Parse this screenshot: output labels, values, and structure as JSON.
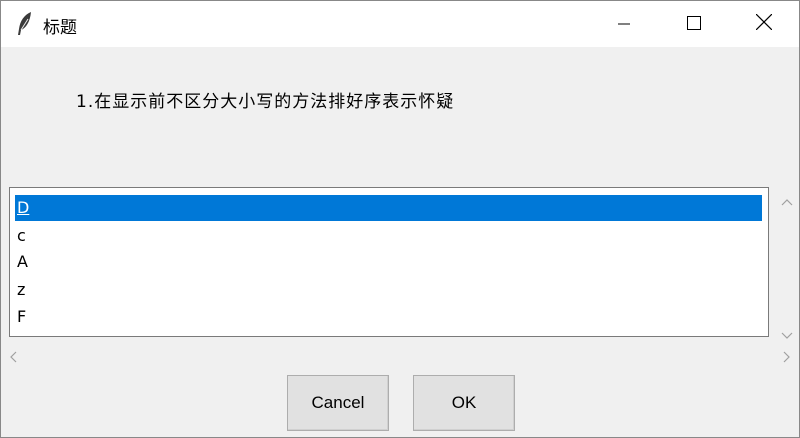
{
  "window": {
    "title": "标题"
  },
  "dialog": {
    "message": "1.在显示前不区分大小写的方法排好序表示怀疑",
    "list": {
      "items": [
        "D",
        "c",
        "A",
        "z",
        "F"
      ],
      "selected_index": 0
    },
    "buttons": {
      "cancel_label": "Cancel",
      "ok_label": "OK"
    }
  },
  "icons": {
    "app": "feather-icon",
    "minimize": "minimize-icon",
    "maximize": "maximize-icon",
    "close": "close-icon",
    "scroll_up": "scroll-up-arrow-icon",
    "scroll_down": "scroll-down-arrow-icon",
    "scroll_left": "scroll-left-arrow-icon",
    "scroll_right": "scroll-right-arrow-icon"
  },
  "colors": {
    "selection": "#0078d7",
    "window_bg": "#f0f0f0",
    "titlebar_bg": "#ffffff"
  }
}
